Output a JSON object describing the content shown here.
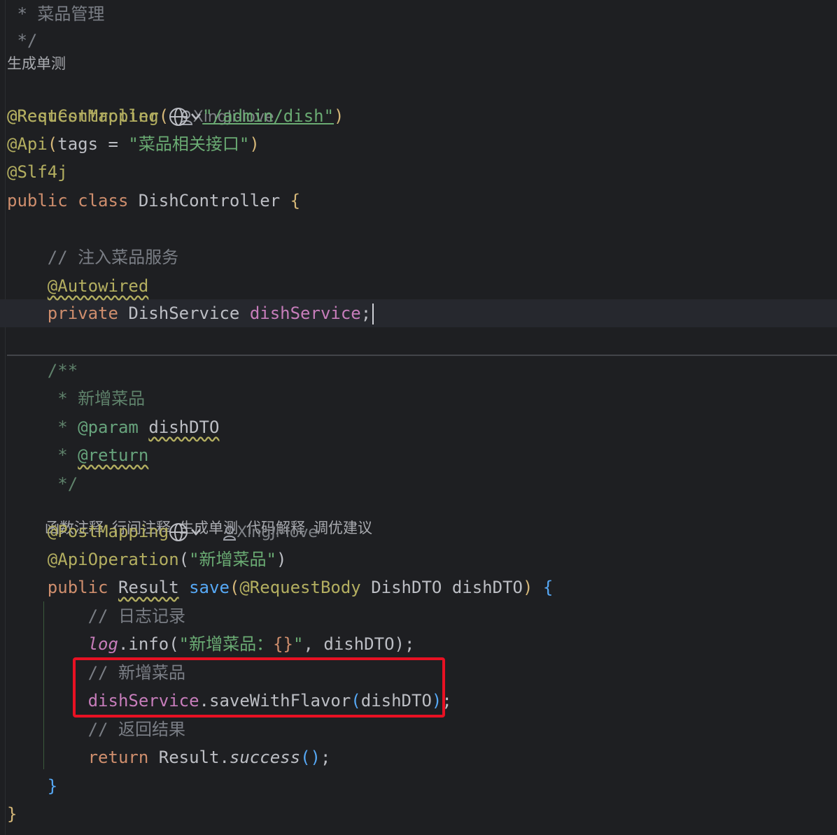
{
  "editor": {
    "header_comment_1": " * 菜品管理",
    "header_comment_2": " */",
    "class_hint": "生成单测",
    "ann_rest": "@RestController",
    "author": "XingJi-love",
    "ann_reqmap": "@RequestMapping",
    "reqmap_path": "\"/admin/dish\"",
    "ann_api": "@Api",
    "api_tags_key": "tags",
    "api_tags_val": "\"菜品相关接口\"",
    "ann_slf4j": "@Slf4j",
    "kw_public": "public",
    "kw_class": "class",
    "class_name": "DishController",
    "comment_inject": "// 注入菜品服务",
    "ann_autowired": "@Autowired",
    "kw_private": "private",
    "type_dishservice": "DishService",
    "field_dishservice": "dishService",
    "doc_start": "/**",
    "doc_line1": " * 新增菜品",
    "doc_param_tag": "@param",
    "doc_param_name": "dishDTO",
    "doc_return_tag": "@return",
    "doc_end": " */",
    "method_hints": [
      "函数注释",
      "行间注释",
      "生成单测",
      "代码解释",
      "调优建议"
    ],
    "ann_postmapping": "@PostMapping",
    "method_author": "XingJi-love",
    "ann_apiop": "@ApiOperation",
    "apiop_val": "\"新增菜品\"",
    "type_result": "Result",
    "method_save": "save",
    "ann_reqbody": "@RequestBody",
    "type_dishdto": "DishDTO",
    "param_dishdto": "dishDTO",
    "comment_log": "// 日志记录",
    "log_obj": "log",
    "log_info": "info",
    "log_str_a": "\"新增菜品：",
    "log_str_b": "{}",
    "log_str_c": "\"",
    "comment_add": "// 新增菜品",
    "method_savewithflavor": "saveWithFlavor",
    "comment_return": "// 返回结果",
    "kw_return": "return",
    "method_success": "success",
    "close_method": "}",
    "close_class": "}"
  },
  "colors": {
    "background": "#1e1f22",
    "highlight_box": "#e81123"
  }
}
